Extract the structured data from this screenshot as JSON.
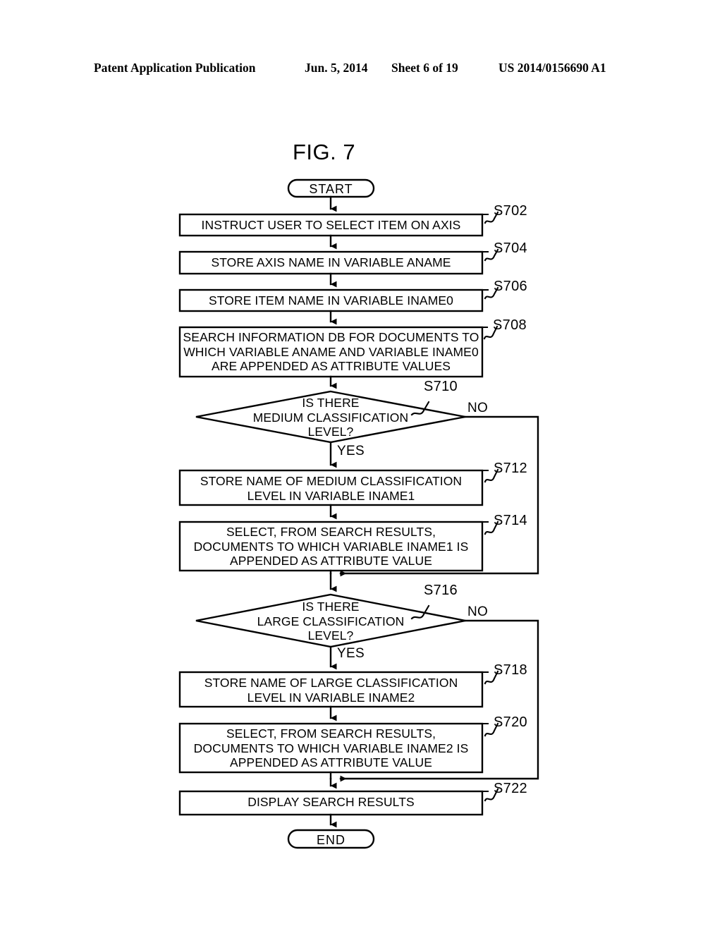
{
  "header": {
    "publication": "Patent Application Publication",
    "date": "Jun. 5, 2014",
    "sheet": "Sheet 6 of 19",
    "patent_number": "US 2014/0156690 A1"
  },
  "figure": {
    "title": "FIG. 7",
    "start_label": "START",
    "end_label": "END",
    "yes_label": "YES",
    "no_label": "NO",
    "line_color": "#000000",
    "fill_color": "#ffffff"
  },
  "chart_data": {
    "type": "flowchart",
    "title": "FIG. 7",
    "nodes": [
      {
        "id": "start",
        "shape": "terminator",
        "text": "START"
      },
      {
        "id": "S702",
        "shape": "process",
        "step": "S702",
        "text": "INSTRUCT USER TO SELECT ITEM ON AXIS"
      },
      {
        "id": "S704",
        "shape": "process",
        "step": "S704",
        "text": "STORE AXIS NAME IN VARIABLE ANAME"
      },
      {
        "id": "S706",
        "shape": "process",
        "step": "S706",
        "text": "STORE ITEM NAME IN VARIABLE INAME0"
      },
      {
        "id": "S708",
        "shape": "process",
        "step": "S708",
        "text": "SEARCH INFORMATION DB FOR DOCUMENTS TO\nWHICH VARIABLE ANAME AND VARIABLE INAME0\nARE APPENDED AS ATTRIBUTE VALUES"
      },
      {
        "id": "S710",
        "shape": "decision",
        "step": "S710",
        "text": "IS THERE\nMEDIUM CLASSIFICATION\nLEVEL?"
      },
      {
        "id": "S712",
        "shape": "process",
        "step": "S712",
        "text": "STORE NAME OF MEDIUM CLASSIFICATION\nLEVEL IN VARIABLE INAME1"
      },
      {
        "id": "S714",
        "shape": "process",
        "step": "S714",
        "text": "SELECT, FROM SEARCH RESULTS,\nDOCUMENTS TO WHICH VARIABLE INAME1 IS\nAPPENDED AS ATTRIBUTE VALUE"
      },
      {
        "id": "S716",
        "shape": "decision",
        "step": "S716",
        "text": "IS THERE\nLARGE CLASSIFICATION\nLEVEL?"
      },
      {
        "id": "S718",
        "shape": "process",
        "step": "S718",
        "text": "STORE NAME OF LARGE CLASSIFICATION\nLEVEL IN VARIABLE INAME2"
      },
      {
        "id": "S720",
        "shape": "process",
        "step": "S720",
        "text": "SELECT, FROM SEARCH RESULTS,\nDOCUMENTS TO WHICH VARIABLE INAME2 IS\nAPPENDED AS ATTRIBUTE VALUE"
      },
      {
        "id": "S722",
        "shape": "process",
        "step": "S722",
        "text": "DISPLAY SEARCH RESULTS"
      },
      {
        "id": "end",
        "shape": "terminator",
        "text": "END"
      }
    ],
    "edges": [
      {
        "from": "start",
        "to": "S702",
        "label": ""
      },
      {
        "from": "S702",
        "to": "S704",
        "label": ""
      },
      {
        "from": "S704",
        "to": "S706",
        "label": ""
      },
      {
        "from": "S706",
        "to": "S708",
        "label": ""
      },
      {
        "from": "S708",
        "to": "S710",
        "label": ""
      },
      {
        "from": "S710",
        "to": "S712",
        "label": "YES"
      },
      {
        "from": "S710",
        "to": "S716",
        "label": "NO"
      },
      {
        "from": "S712",
        "to": "S714",
        "label": ""
      },
      {
        "from": "S714",
        "to": "S716",
        "label": ""
      },
      {
        "from": "S716",
        "to": "S718",
        "label": "YES"
      },
      {
        "from": "S716",
        "to": "S722",
        "label": "NO"
      },
      {
        "from": "S718",
        "to": "S720",
        "label": ""
      },
      {
        "from": "S720",
        "to": "S722",
        "label": ""
      },
      {
        "from": "S722",
        "to": "end",
        "label": ""
      }
    ]
  },
  "nodes": {
    "start": {
      "text": "START"
    },
    "s702": {
      "step": "S702",
      "text": "INSTRUCT USER TO SELECT ITEM ON AXIS"
    },
    "s704": {
      "step": "S704",
      "text": "STORE AXIS NAME IN VARIABLE ANAME"
    },
    "s706": {
      "step": "S706",
      "text": "STORE ITEM NAME IN VARIABLE INAME0"
    },
    "s708": {
      "step": "S708",
      "text": "SEARCH INFORMATION DB FOR DOCUMENTS TO\nWHICH VARIABLE ANAME AND VARIABLE INAME0\nARE APPENDED AS ATTRIBUTE VALUES"
    },
    "s710": {
      "step": "S710",
      "text": "IS THERE\nMEDIUM CLASSIFICATION\nLEVEL?",
      "yes": "YES",
      "no": "NO"
    },
    "s712": {
      "step": "S712",
      "text": "STORE NAME OF MEDIUM CLASSIFICATION\nLEVEL IN VARIABLE INAME1"
    },
    "s714": {
      "step": "S714",
      "text": "SELECT, FROM SEARCH RESULTS,\nDOCUMENTS TO WHICH VARIABLE INAME1 IS\nAPPENDED AS ATTRIBUTE VALUE"
    },
    "s716": {
      "step": "S716",
      "text": "IS THERE\nLARGE CLASSIFICATION\nLEVEL?",
      "yes": "YES",
      "no": "NO"
    },
    "s718": {
      "step": "S718",
      "text": "STORE NAME OF LARGE CLASSIFICATION\nLEVEL IN VARIABLE INAME2"
    },
    "s720": {
      "step": "S720",
      "text": "SELECT, FROM SEARCH RESULTS,\nDOCUMENTS TO WHICH VARIABLE INAME2 IS\nAPPENDED AS ATTRIBUTE VALUE"
    },
    "s722": {
      "step": "S722",
      "text": "DISPLAY SEARCH RESULTS"
    },
    "end": {
      "text": "END"
    }
  }
}
